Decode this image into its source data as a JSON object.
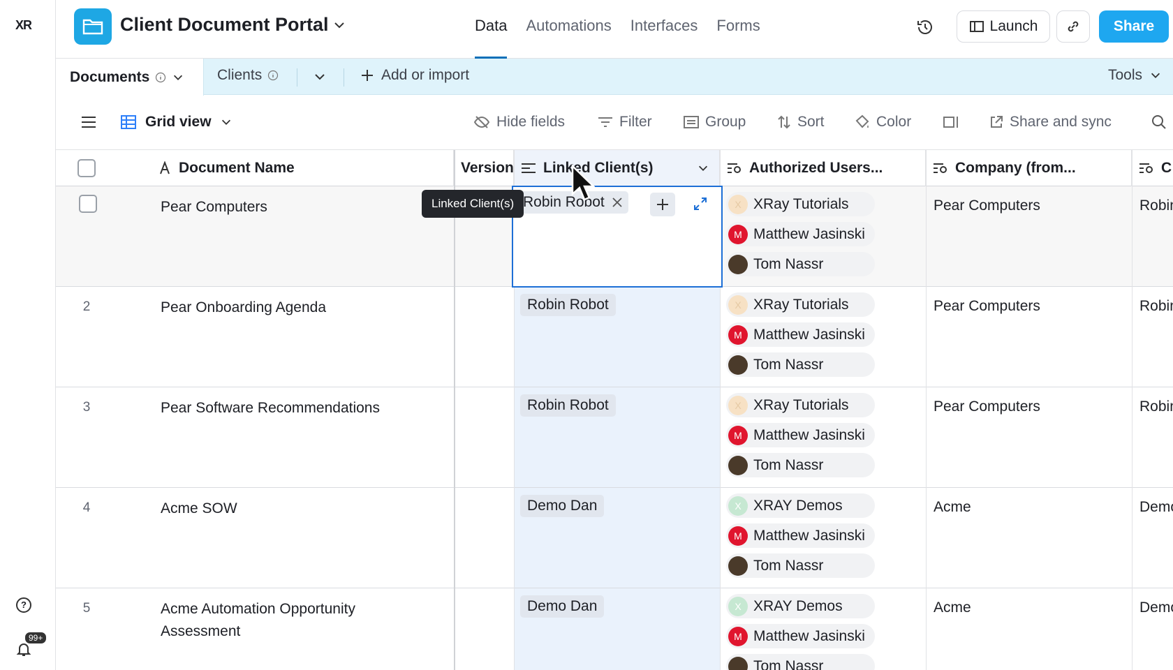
{
  "rail": {
    "logo": "XR",
    "help": "?",
    "notif_badge": "99+"
  },
  "header": {
    "title": "Client Document Portal",
    "nav": [
      {
        "label": "Data",
        "active": true
      },
      {
        "label": "Automations"
      },
      {
        "label": "Interfaces"
      },
      {
        "label": "Forms"
      }
    ],
    "launch_label": "Launch",
    "share_label": "Share"
  },
  "tables": {
    "documents": "Documents",
    "clients": "Clients",
    "add": "Add or import",
    "tools": "Tools"
  },
  "viewbar": {
    "view_name": "Grid view",
    "tools": [
      "Hide fields",
      "Filter",
      "Group",
      "Sort",
      "Color",
      "Share and sync"
    ]
  },
  "columns": {
    "name": "Document Name",
    "version": "Version",
    "linked": "Linked Client(s)",
    "authorized": "Authorized Users...",
    "company": "Company (from...",
    "last": "C"
  },
  "rows": [
    {
      "num": "",
      "name": "Pear Computers",
      "client": "Robin Robot",
      "users": [
        "XRay Tutorials",
        "Matthew Jasinski",
        "Tom Nassr"
      ],
      "company": "Pear Computers",
      "last": "Robin"
    },
    {
      "num": "2",
      "name": "Pear Onboarding Agenda",
      "client": "Robin Robot",
      "users": [
        "XRay Tutorials",
        "Matthew Jasinski",
        "Tom Nassr"
      ],
      "company": "Pear Computers",
      "last": "Robin"
    },
    {
      "num": "3",
      "name": "Pear Software Recommendations",
      "client": "Robin Robot",
      "users": [
        "XRay Tutorials",
        "Matthew Jasinski",
        "Tom Nassr"
      ],
      "company": "Pear Computers",
      "last": "Robin"
    },
    {
      "num": "4",
      "name": "Acme SOW",
      "client": "Demo Dan",
      "users": [
        "XRAY Demos",
        "Matthew Jasinski",
        "Tom Nassr"
      ],
      "company": "Acme",
      "last": "Demo"
    },
    {
      "num": "5",
      "name": "Acme Automation Opportunity Assessment",
      "client": "Demo Dan",
      "users": [
        "XRAY Demos",
        "Matthew Jasinski",
        "Tom Nassr"
      ],
      "company": "Acme",
      "last": "Demo"
    }
  ],
  "active_cell_value": "Robin Robot",
  "tooltip": "Linked Client(s)",
  "colors": {
    "accent": "#1ea7f0",
    "selection": "#1d6fd6",
    "table_bar": "#dff3fb"
  }
}
